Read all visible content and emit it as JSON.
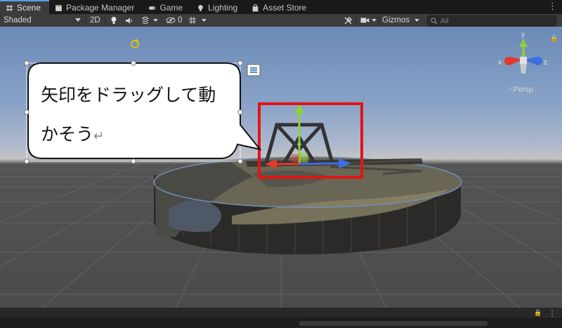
{
  "tabs": [
    {
      "label": "Scene",
      "icon": "grid-icon",
      "active": true
    },
    {
      "label": "Package Manager",
      "icon": "package-icon"
    },
    {
      "label": "Game",
      "icon": "gamepad-icon"
    },
    {
      "label": "Lighting",
      "icon": "bulb-icon"
    },
    {
      "label": "Asset Store",
      "icon": "bag-icon"
    }
  ],
  "toolbar": {
    "shading_mode": "Shaded",
    "mode_2d": "2D",
    "hidden_count": "0",
    "gizmos_label": "Gizmos",
    "search_placeholder": "All"
  },
  "gizmo": {
    "axis_x": "x",
    "axis_y": "y",
    "axis_z": "z",
    "projection": "Persp"
  },
  "callout": {
    "line1": "矢印をドラッグして動",
    "line2": "かそう",
    "return_mark": "↵"
  },
  "colors": {
    "highlight_box": "#e21515",
    "axis_x": "#e23b2a",
    "axis_y": "#8ed03a",
    "axis_z": "#3b6fe2",
    "tab_accent": "#5a9bf0"
  }
}
